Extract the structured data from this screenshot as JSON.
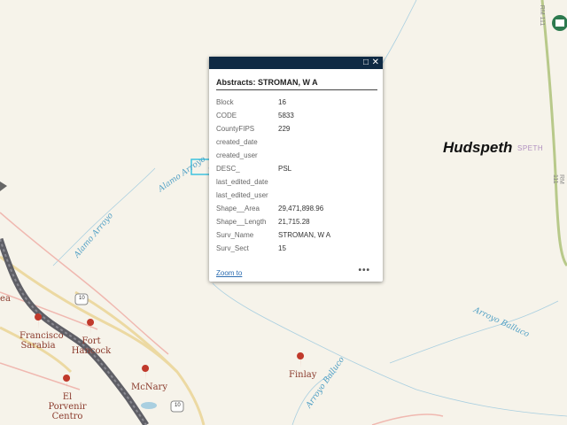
{
  "popup": {
    "title": "Abstracts: STROMAN, W A",
    "fields": [
      {
        "key": "Block",
        "value": "16"
      },
      {
        "key": "CODE",
        "value": "5833"
      },
      {
        "key": "CountyFIPS",
        "value": "229"
      },
      {
        "key": "created_date",
        "value": ""
      },
      {
        "key": "created_user",
        "value": ""
      },
      {
        "key": "DESC_",
        "value": "PSL"
      },
      {
        "key": "last_edited_date",
        "value": ""
      },
      {
        "key": "last_edited_user",
        "value": ""
      },
      {
        "key": "Shape__Area",
        "value": "29,471,898.96"
      },
      {
        "key": "Shape__Length",
        "value": "21,715.28"
      },
      {
        "key": "Surv_Name",
        "value": "STROMAN, W A"
      },
      {
        "key": "Surv_Sect",
        "value": "15"
      }
    ],
    "zoom_label": "Zoom to",
    "more_label": "•••",
    "maximize_icon": "maximize-icon",
    "close_icon": "close-icon"
  },
  "map": {
    "county_label": "Hudspeth",
    "county_ghost_label": "SPETH",
    "places": {
      "francisco": "Francisco\nSarabia",
      "fort_hancock": "Fort Hancock",
      "el_porvenir": "El Porvenir\nCentro",
      "mcnary": "McNary",
      "finlay": "Finlay",
      "left_edge": "ea"
    },
    "waterways": {
      "alamo_upper": "Alamo Arroyo",
      "alamo_lower": "Alamo Arroyo",
      "arroyo_balluco": "Arroyo Balluco",
      "arroyo_balluco_2": "Arroyo Balluco"
    },
    "highways": {
      "i10_a": "10",
      "i10_b": "10"
    },
    "edge_road_top": "RM 111",
    "edge_road_mid": "RM 111",
    "colors": {
      "background": "#f6f3ea",
      "interstate": "#5f5f66",
      "highway": "#ecd9a2",
      "local_road": "#f0b8b0",
      "water": "#a9cfe0",
      "selection": "#3ec3e0",
      "popup_header": "#0f2a44",
      "poi": "#c0392b",
      "green_road": "#b8c98a"
    }
  }
}
